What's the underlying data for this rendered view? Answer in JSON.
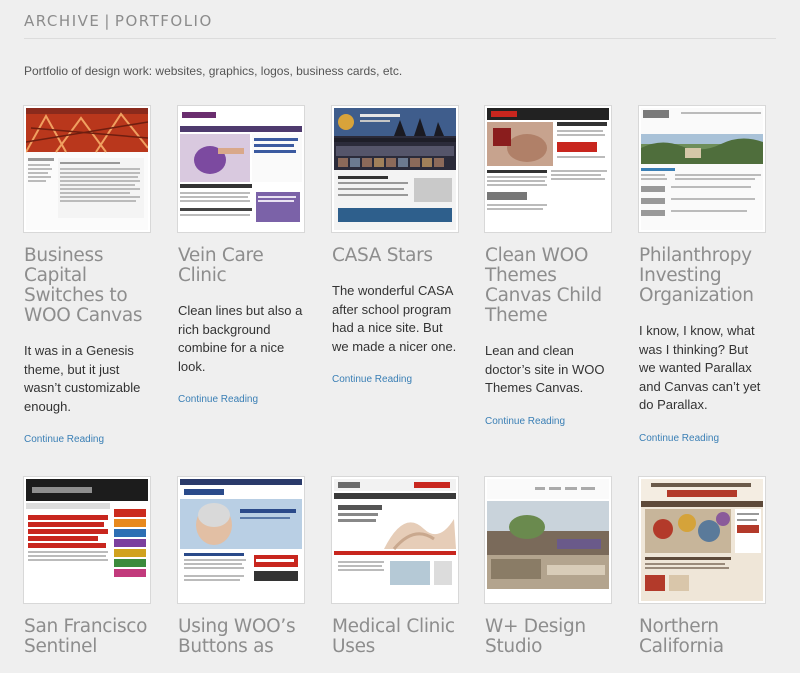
{
  "archive": {
    "label": "ARCHIVE",
    "separator": "|",
    "category": "PORTFOLIO",
    "intro": "Portfolio of design work: websites, graphics, logos, business cards, etc."
  },
  "items": [
    {
      "title": "Business Capital Switches to WOO Canvas",
      "excerpt": "It was in a Genesis theme, but it just wasn’t customizable enough.",
      "link": "Continue Reading"
    },
    {
      "title": "Vein Care Clinic",
      "excerpt": "Clean lines but also a rich background combine for a nice look.",
      "link": "Continue Reading"
    },
    {
      "title": "CASA Stars",
      "excerpt": "The wonderful CASA after school program had a nice site. But we made a nicer one.",
      "link": "Continue Reading"
    },
    {
      "title": "Clean WOO Themes Canvas Child Theme",
      "excerpt": "Lean and clean doctor’s site in WOO Themes Canvas.",
      "link": "Continue Reading"
    },
    {
      "title": "Philanthropy Investing Organization",
      "excerpt": "I know, I know, what was I thinking? But we wanted Parallax and Canvas can’t yet do Parallax.",
      "link": "Continue Reading"
    },
    {
      "title": "San Francisco Sentinel"
    },
    {
      "title": "Using WOO’s Buttons as"
    },
    {
      "title": "Medical Clinic Uses"
    },
    {
      "title": "W+ Design Studio"
    },
    {
      "title": "Northern California"
    }
  ]
}
